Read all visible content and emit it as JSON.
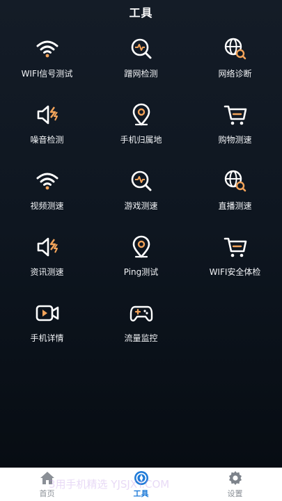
{
  "header": {
    "title": "工具"
  },
  "colors": {
    "accent": "#f4a45a",
    "icon_white": "#ffffff",
    "tab_active": "#1f7bd8",
    "tab_inactive": "#8a8f96"
  },
  "tools": [
    {
      "label": "WIFI信号测试",
      "icon": "wifi-icon"
    },
    {
      "label": "蹭网检测",
      "icon": "search-pulse-icon"
    },
    {
      "label": "网络诊断",
      "icon": "globe-search-icon"
    },
    {
      "label": "噪音检测",
      "icon": "speaker-icon"
    },
    {
      "label": "手机归属地",
      "icon": "location-pin-icon"
    },
    {
      "label": "购物测速",
      "icon": "shopping-cart-icon"
    },
    {
      "label": "视频测速",
      "icon": "wifi-icon"
    },
    {
      "label": "游戏测速",
      "icon": "search-pulse-icon"
    },
    {
      "label": "直播测速",
      "icon": "globe-search-icon"
    },
    {
      "label": "资讯测速",
      "icon": "speaker-icon"
    },
    {
      "label": "Ping测试",
      "icon": "location-pin-icon"
    },
    {
      "label": "WIFI安全体检",
      "icon": "shopping-cart-icon"
    },
    {
      "label": "手机详情",
      "icon": "video-camera-icon"
    },
    {
      "label": "流量监控",
      "icon": "gamepad-icon"
    }
  ],
  "tabbar": {
    "home": {
      "label": "首页",
      "icon": "home-icon"
    },
    "tools": {
      "label": "工具",
      "icon": "compass-icon"
    },
    "settings": {
      "label": "设置",
      "icon": "gear-icon"
    }
  },
  "watermark": "3用手机精选 YJSJXY.COM"
}
